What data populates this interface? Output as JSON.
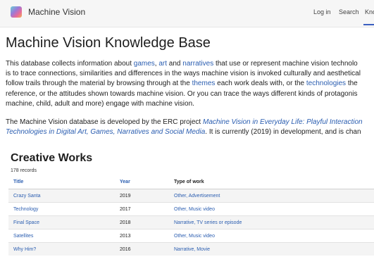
{
  "header": {
    "brand": "Machine Vision",
    "nav": {
      "login": "Log in",
      "search": "Search",
      "knowledge": "Kno"
    }
  },
  "main": {
    "title": "Machine Vision Knowledge Base",
    "intro": {
      "p1_a": "This database collects information about ",
      "link_games": "games",
      "p1_b": ", ",
      "link_art": "art",
      "p1_c": " and ",
      "link_narratives": "narratives",
      "p1_d": " that use or represent machine vision technolo",
      "p1_e": "is to trace connections, similarities and differences in the ways machine vision is invoked culturally and aesthetical",
      "p1_f": "follow trails through the material by browsing through at the ",
      "link_themes": "themes",
      "p1_g": " each work deals with, or the ",
      "link_technologies": "technologies",
      "p1_h": " the",
      "p1_i": "reference, or the attitudes shown towards machine vision. Or you can trace the ways different kinds of protagonis",
      "p1_j": "machine, child, adult and more) engage with machine vision."
    },
    "intro2": {
      "a": "The Machine Vision database is developed by the ERC project ",
      "link_project_1": "Machine Vision in Everyday Life: Playful Interaction",
      "link_project_2": "Technologies in Digital Art, Games, Narratives and Social Media",
      "b": ". It is currently (2019) in development, and is chan"
    }
  },
  "creative_works": {
    "title": "Creative Works",
    "records": "178 records",
    "columns": {
      "title": "Title",
      "year": "Year",
      "type": "Type of work"
    },
    "rows": [
      {
        "title": "Crazy Santa",
        "year": "2019",
        "type": "Other, Advertisement"
      },
      {
        "title": "Technology",
        "year": "2017",
        "type": "Other, Music video"
      },
      {
        "title": "Final Space",
        "year": "2018",
        "type": "Narrative, TV series or episode"
      },
      {
        "title": "Satellites",
        "year": "2013",
        "type": "Other, Music video"
      },
      {
        "title": "Why Him?",
        "year": "2016",
        "type": "Narrative, Movie"
      }
    ]
  }
}
